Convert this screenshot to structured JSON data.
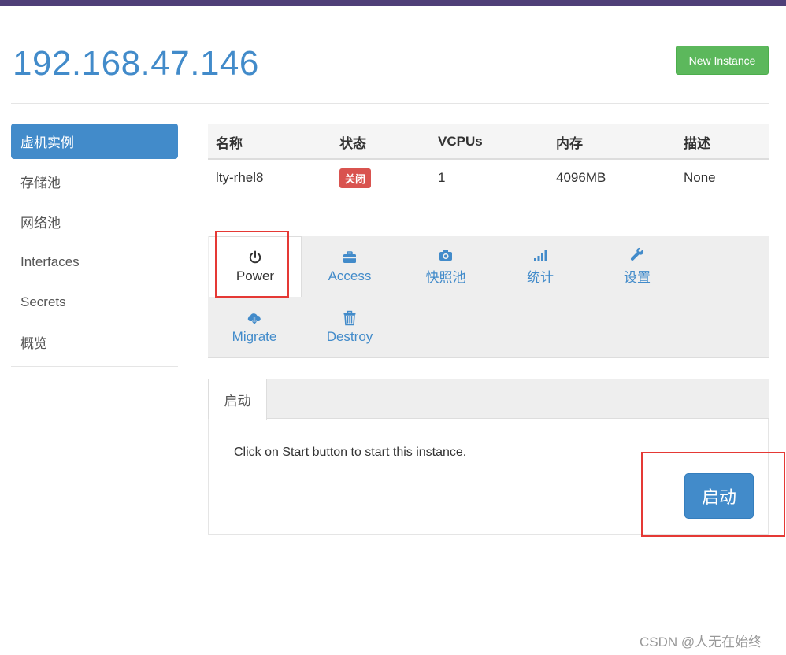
{
  "header": {
    "title": "192.168.47.146",
    "new_instance_label": "New Instance"
  },
  "sidebar": {
    "items": [
      {
        "label": "虚机实例",
        "active": true
      },
      {
        "label": "存储池"
      },
      {
        "label": "网络池"
      },
      {
        "label": "Interfaces"
      },
      {
        "label": "Secrets"
      },
      {
        "label": "概览"
      }
    ]
  },
  "table": {
    "headers": [
      "名称",
      "状态",
      "VCPUs",
      "内存",
      "描述"
    ],
    "rows": [
      {
        "name": "lty-rhel8",
        "status": "关闭",
        "vcpus": "1",
        "memory": "4096MB",
        "description": "None"
      }
    ]
  },
  "actions": {
    "items": [
      {
        "label": "Power",
        "icon": "power-icon"
      },
      {
        "label": "Access",
        "icon": "briefcase-icon"
      },
      {
        "label": "快照池",
        "icon": "camera-icon"
      },
      {
        "label": "统计",
        "icon": "signal-bars-icon"
      },
      {
        "label": "设置",
        "icon": "wrench-icon"
      },
      {
        "label": "Migrate",
        "icon": "cloud-download-icon"
      },
      {
        "label": "Destroy",
        "icon": "trash-icon"
      }
    ]
  },
  "power_panel": {
    "tab_label": "启动",
    "message": "Click on Start button to start this instance.",
    "start_label": "启动"
  },
  "watermark": "CSDN @人无在始终",
  "colors": {
    "primary": "#428bca",
    "success": "#5cb85c",
    "danger": "#d9534f",
    "topbar": "#4f3f78",
    "highlight": "#e53935"
  }
}
